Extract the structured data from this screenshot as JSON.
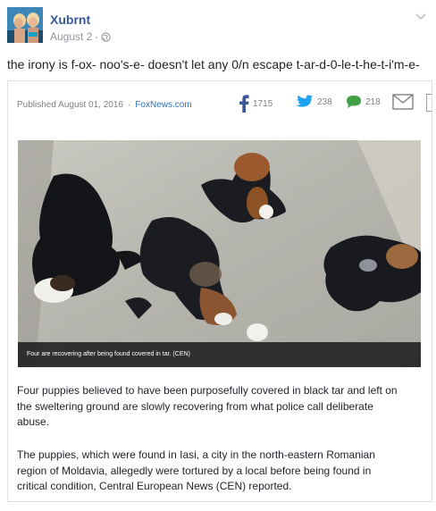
{
  "post": {
    "author": "Xubrnt",
    "date": "August 2",
    "separator": "·",
    "text": "the irony is f-ox- noo's-e- doesn't let any 0/n escape t-ar-d-0-le-t-he-t-i'm-e-"
  },
  "article": {
    "published": "Published August 01, 2016",
    "separator": "·",
    "source": "FoxNews.com",
    "shares": {
      "facebook": "1715",
      "twitter": "238",
      "comments": "218"
    },
    "caption": "Four are recovering after being found covered in tar. (CEN)",
    "paragraph1": [
      "Four puppies believed to have been purposefully covered in black tar and left on",
      "the sweltering ground are slowly recovering from what police call deliberate",
      "abuse."
    ],
    "paragraph2": [
      "The puppies, which were found in Iasi, a city in the north-eastern Romanian",
      "region of Moldavia, allegedly were tortured by a local before being found in",
      "critical condition, Central European News (CEN) reported."
    ]
  },
  "icons": {
    "avatar": "profile-photo",
    "menu": "chevron-down-icon",
    "audience": "globe-icon",
    "facebook": "facebook-icon",
    "twitter": "twitter-icon",
    "comments": "comment-bubble-icon",
    "mail": "mail-icon"
  },
  "colors": {
    "link": "#365899",
    "source": "#2a6fb7",
    "facebook": "#3b5998",
    "twitter": "#1da1f2",
    "comments": "#43a047",
    "muted": "#90949c"
  }
}
